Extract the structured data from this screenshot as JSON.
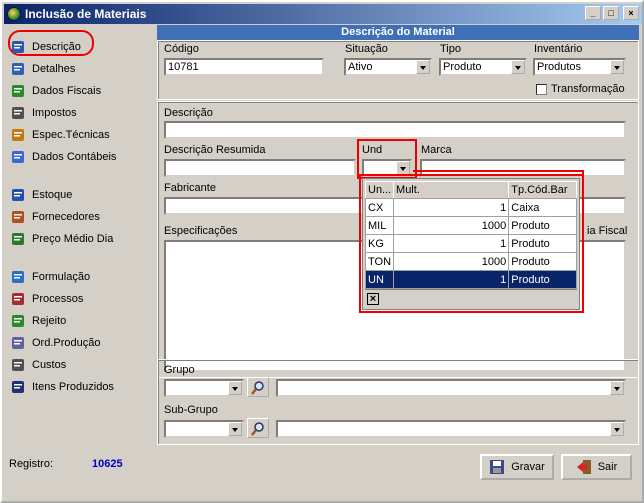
{
  "window": {
    "title": "Inclusão de Materiais",
    "minimize": "_",
    "maximize": "□",
    "close": "×"
  },
  "sidebar": {
    "items": [
      {
        "label": "Descrição",
        "icon": "document-icon"
      },
      {
        "label": "Detalhes",
        "icon": "details-list-icon"
      },
      {
        "label": "Dados Fiscais",
        "icon": "dollar-icon"
      },
      {
        "label": "Impostos",
        "icon": "calculator-icon"
      },
      {
        "label": "Espec.Técnicas",
        "icon": "tech-spec-icon"
      },
      {
        "label": "Dados Contábeis",
        "icon": "accounting-icon"
      },
      {
        "label": "Estoque",
        "icon": "bar-chart-icon"
      },
      {
        "label": "Fornecedores",
        "icon": "users-icon"
      },
      {
        "label": "Preço Médio Dia",
        "icon": "price-icon"
      },
      {
        "label": "Formulação",
        "icon": "flask-icon"
      },
      {
        "label": "Processos",
        "icon": "gears-icon"
      },
      {
        "label": "Rejeito",
        "icon": "recycle-icon"
      },
      {
        "label": "Ord.Produção",
        "icon": "clipboard-icon"
      },
      {
        "label": "Custos",
        "icon": "calculator-icon"
      },
      {
        "label": "Itens Produzidos",
        "icon": "list-icon"
      }
    ]
  },
  "header": {
    "title": "Descrição do Material"
  },
  "form": {
    "codigo_label": "Código",
    "codigo_value": "10781",
    "situacao_label": "Situação",
    "situacao_value": "Ativo",
    "tipo_label": "Tipo",
    "tipo_value": "Produto",
    "inventario_label": "Inventário",
    "inventario_value": "Produtos",
    "transformacao_label": "Transformação",
    "descricao_label": "Descrição",
    "desc_resumida_label": "Descrição Resumida",
    "und_label": "Und",
    "marca_label": "Marca",
    "fabricante_label": "Fabricante",
    "especificacoes_label": "Especificações",
    "fiscal_label_partial": "ia Fiscal",
    "grupo_label": "Grupo",
    "subgrupo_label": "Sub-Grupo"
  },
  "und_grid": {
    "headers": [
      "Un...",
      "Mult.",
      "Tp.Cód.Bar"
    ],
    "rows": [
      [
        "CX",
        "1",
        "Caixa"
      ],
      [
        "MIL",
        "1000",
        "Produto"
      ],
      [
        "KG",
        "1",
        "Produto"
      ],
      [
        "TON",
        "1000",
        "Produto"
      ],
      [
        "UN",
        "1",
        "Produto"
      ]
    ],
    "close": "×"
  },
  "footer": {
    "registro_label": "Registro:",
    "registro_value": "10625",
    "save_label": "Gravar",
    "exit_label": "Sair"
  },
  "colors": {
    "header": "#3f6fb7",
    "highlight": "#e00000",
    "registro": "#0000c0"
  }
}
